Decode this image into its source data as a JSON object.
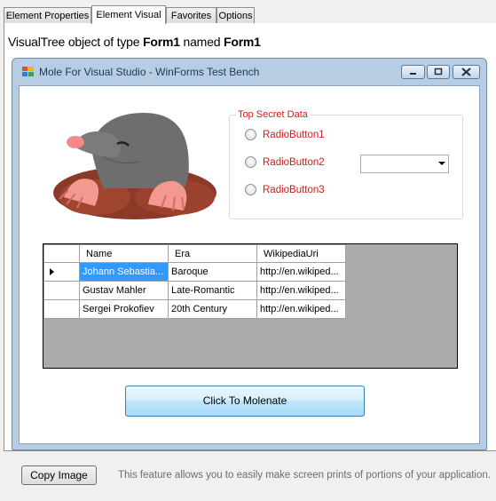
{
  "tabs": [
    {
      "label": "Element Properties",
      "active": false
    },
    {
      "label": "Element Visual",
      "active": true
    },
    {
      "label": "Favorites",
      "active": false
    },
    {
      "label": "Options",
      "active": false
    }
  ],
  "visual_tree": {
    "prefix": "VisualTree object of type ",
    "type_name": "Form1",
    "middle": " named ",
    "object_name": "Form1"
  },
  "window": {
    "title": "Mole For Visual Studio - WinForms Test Bench",
    "icon": "app-icon",
    "controls": [
      "minimize-icon",
      "maximize-icon",
      "close-icon"
    ]
  },
  "group": {
    "legend": "Top Secret Data",
    "radios": [
      "RadioButton1",
      "RadioButton2",
      "RadioButton3"
    ],
    "combo_value": ""
  },
  "grid": {
    "columns": [
      "Name",
      "Era",
      "WikipediaUri"
    ],
    "rows": [
      [
        "Johann Sebastia...",
        "Baroque",
        "http://en.wikiped..."
      ],
      [
        "Gustav Mahler",
        "Late-Romantic",
        "http://en.wikiped..."
      ],
      [
        "Sergei Prokofiev",
        "20th Century",
        "http://en.wikiped..."
      ]
    ],
    "selected_row": 0
  },
  "molenate_button": "Click To Molenate",
  "footer": {
    "copy_button": "Copy Image",
    "hint": "This feature allows you to easily make screen prints of portions of your application."
  },
  "colors": {
    "accent_red": "#d01b1b",
    "selection": "#3399ff",
    "window_frame": "#b6cde3"
  }
}
